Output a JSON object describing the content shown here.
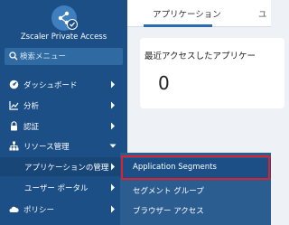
{
  "sidebar": {
    "brand": "Zscaler Private Access",
    "search": {
      "placeholder": "検索メニュー"
    },
    "items": [
      {
        "label": "ダッシュボード",
        "icon": "dashboard-icon"
      },
      {
        "label": "分析",
        "icon": "line-chart-icon"
      },
      {
        "label": "認証",
        "icon": "lock-icon"
      },
      {
        "label": "リソース管理",
        "icon": "sitemap-icon",
        "expanded": true
      },
      {
        "label": "アプリケーションの管理"
      },
      {
        "label": "ユーザー ポータル"
      },
      {
        "label": "ポリシー",
        "icon": "cloud-icon"
      }
    ]
  },
  "main": {
    "tabs": [
      {
        "label": "アプリケーション",
        "active": true
      },
      {
        "label": "ユ"
      }
    ],
    "card": {
      "title": "最近アクセスしたアプリケー",
      "value": "0"
    }
  },
  "submenu": {
    "items": [
      {
        "label": "Application Segments",
        "highlighted": true
      },
      {
        "label": "セグメント グループ"
      },
      {
        "label": "ブラウザー アクセス"
      }
    ]
  },
  "colors": {
    "sidebar_bg": "#1b4f86",
    "submenu_bg": "#2b5d91",
    "highlight": "#e0202e",
    "accent": "#2b6cb0"
  }
}
